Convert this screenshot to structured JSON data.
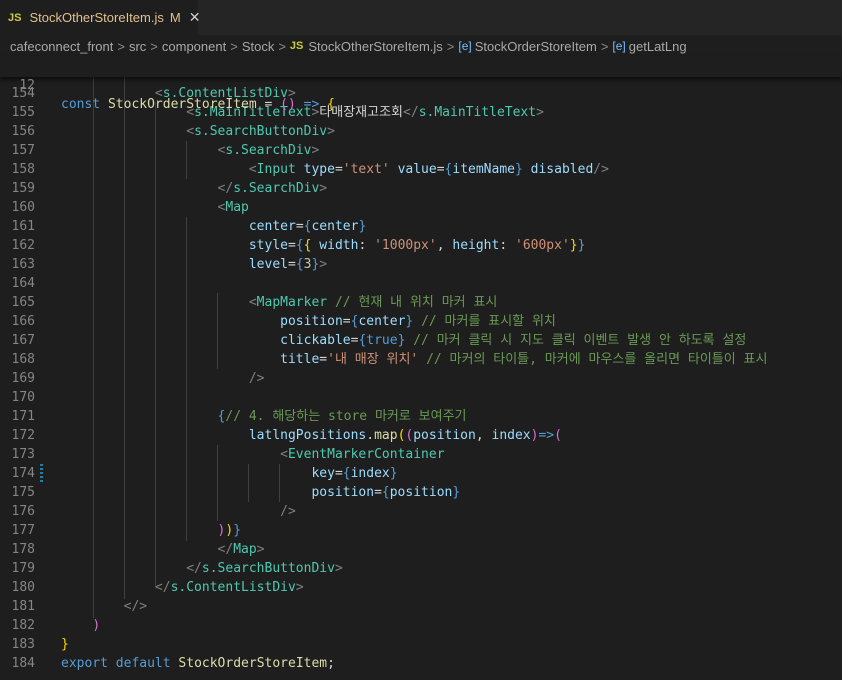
{
  "tab": {
    "icon": "JS",
    "filename": "StockOtherStoreItem.js",
    "modified": "M",
    "close": "✕"
  },
  "breadcrumb": {
    "parts": [
      "cafeconnect_front",
      "src",
      "component",
      "Stock",
      "StockOtherStoreItem.js",
      "StockOrderStoreItem",
      "getLatLng"
    ],
    "js_icon": "JS",
    "symbol_icon": "[e]",
    "separator": ">"
  },
  "sticky": {
    "line_number": "12",
    "kw": "const",
    "name": "StockOrderStoreItem",
    "rest1": " = ",
    "paren": "()",
    "rest2": " => ",
    "brace": "{"
  },
  "lines": [
    {
      "n": "154",
      "t": [
        [
          "txt",
          "            "
        ],
        [
          "br",
          "<"
        ],
        [
          "cmp",
          "s.ContentListDiv"
        ],
        [
          "br",
          ">"
        ]
      ]
    },
    {
      "n": "155",
      "t": [
        [
          "txt",
          "                "
        ],
        [
          "br",
          "<"
        ],
        [
          "cmp",
          "s.MainTitleText"
        ],
        [
          "br",
          ">"
        ],
        [
          "txt",
          "타매장재고조회"
        ],
        [
          "br",
          "</"
        ],
        [
          "cmp",
          "s.MainTitleText"
        ],
        [
          "br",
          ">"
        ]
      ]
    },
    {
      "n": "156",
      "t": [
        [
          "txt",
          "                "
        ],
        [
          "br",
          "<"
        ],
        [
          "cmp",
          "s.SearchButtonDiv"
        ],
        [
          "br",
          ">"
        ]
      ]
    },
    {
      "n": "157",
      "t": [
        [
          "txt",
          "                    "
        ],
        [
          "br",
          "<"
        ],
        [
          "cmp",
          "s.SearchDiv"
        ],
        [
          "br",
          ">"
        ]
      ]
    },
    {
      "n": "158",
      "t": [
        [
          "txt",
          "                        "
        ],
        [
          "br",
          "<"
        ],
        [
          "cmp",
          "Input"
        ],
        [
          "txt",
          " "
        ],
        [
          "attr",
          "type"
        ],
        [
          "txt",
          "="
        ],
        [
          "str",
          "'text'"
        ],
        [
          "txt",
          " "
        ],
        [
          "attr",
          "value"
        ],
        [
          "txt",
          "="
        ],
        [
          "kw",
          "{"
        ],
        [
          "attr",
          "itemName"
        ],
        [
          "kw",
          "}"
        ],
        [
          "txt",
          " "
        ],
        [
          "attr",
          "disabled"
        ],
        [
          "br",
          "/>"
        ]
      ]
    },
    {
      "n": "159",
      "t": [
        [
          "txt",
          "                    "
        ],
        [
          "br",
          "</"
        ],
        [
          "cmp",
          "s.SearchDiv"
        ],
        [
          "br",
          ">"
        ]
      ]
    },
    {
      "n": "160",
      "t": [
        [
          "txt",
          "                    "
        ],
        [
          "br",
          "<"
        ],
        [
          "cmp",
          "Map"
        ]
      ]
    },
    {
      "n": "161",
      "t": [
        [
          "txt",
          "                        "
        ],
        [
          "attr",
          "center"
        ],
        [
          "txt",
          "="
        ],
        [
          "kw",
          "{"
        ],
        [
          "attr",
          "center"
        ],
        [
          "kw",
          "}"
        ]
      ]
    },
    {
      "n": "162",
      "t": [
        [
          "txt",
          "                        "
        ],
        [
          "attr",
          "style"
        ],
        [
          "txt",
          "="
        ],
        [
          "kw",
          "{"
        ],
        [
          "b1",
          "{"
        ],
        [
          "txt",
          " "
        ],
        [
          "attr",
          "width"
        ],
        [
          "txt",
          ": "
        ],
        [
          "str",
          "'1000px'"
        ],
        [
          "txt",
          ", "
        ],
        [
          "attr",
          "height"
        ],
        [
          "txt",
          ": "
        ],
        [
          "str",
          "'600px'"
        ],
        [
          "b1",
          "}"
        ],
        [
          "kw",
          "}"
        ]
      ]
    },
    {
      "n": "163",
      "t": [
        [
          "txt",
          "                        "
        ],
        [
          "attr",
          "level"
        ],
        [
          "txt",
          "="
        ],
        [
          "kw",
          "{"
        ],
        [
          "num",
          "3"
        ],
        [
          "kw",
          "}"
        ],
        [
          "br",
          ">"
        ]
      ]
    },
    {
      "n": "164",
      "t": []
    },
    {
      "n": "165",
      "t": [
        [
          "txt",
          "                        "
        ],
        [
          "br",
          "<"
        ],
        [
          "cmp",
          "MapMarker"
        ],
        [
          "txt",
          " "
        ],
        [
          "cm",
          "// 현재 내 위치 마커 표시"
        ]
      ]
    },
    {
      "n": "166",
      "t": [
        [
          "txt",
          "                            "
        ],
        [
          "attr",
          "position"
        ],
        [
          "txt",
          "="
        ],
        [
          "kw",
          "{"
        ],
        [
          "attr",
          "center"
        ],
        [
          "kw",
          "}"
        ],
        [
          "txt",
          " "
        ],
        [
          "cm",
          "// 마커를 표시할 위치"
        ]
      ]
    },
    {
      "n": "167",
      "t": [
        [
          "txt",
          "                            "
        ],
        [
          "attr",
          "clickable"
        ],
        [
          "txt",
          "="
        ],
        [
          "kw",
          "{true}"
        ],
        [
          "txt",
          " "
        ],
        [
          "cm",
          "// 마커 클릭 시 지도 클릭 이벤트 발생 안 하도록 설정"
        ]
      ]
    },
    {
      "n": "168",
      "t": [
        [
          "txt",
          "                            "
        ],
        [
          "attr",
          "title"
        ],
        [
          "txt",
          "="
        ],
        [
          "str",
          "'내 매장 위치'"
        ],
        [
          "txt",
          " "
        ],
        [
          "cm",
          "// 마커의 타이틀, 마커에 마우스를 올리면 타이틀이 표시"
        ]
      ]
    },
    {
      "n": "169",
      "t": [
        [
          "txt",
          "                        "
        ],
        [
          "br",
          "/>"
        ]
      ]
    },
    {
      "n": "170",
      "t": []
    },
    {
      "n": "171",
      "t": [
        [
          "txt",
          "                    "
        ],
        [
          "kw",
          "{"
        ],
        [
          "cm",
          "// 4. 해당하는 store 마커로 보여주기"
        ]
      ]
    },
    {
      "n": "172",
      "t": [
        [
          "txt",
          "                        "
        ],
        [
          "attr",
          "latlngPositions"
        ],
        [
          "txt",
          "."
        ],
        [
          "fn",
          "map"
        ],
        [
          "b1",
          "("
        ],
        [
          "b2",
          "("
        ],
        [
          "attr",
          "position"
        ],
        [
          "txt",
          ", "
        ],
        [
          "attr",
          "index"
        ],
        [
          "b2",
          ")"
        ],
        [
          "kw",
          "=>"
        ],
        [
          "b2",
          "("
        ]
      ]
    },
    {
      "n": "173",
      "t": [
        [
          "txt",
          "                            "
        ],
        [
          "br",
          "<"
        ],
        [
          "cmp",
          "EventMarkerContainer"
        ]
      ]
    },
    {
      "n": "174",
      "t": [
        [
          "txt",
          "                                "
        ],
        [
          "attr",
          "key"
        ],
        [
          "txt",
          "="
        ],
        [
          "kw",
          "{"
        ],
        [
          "attr",
          "index"
        ],
        [
          "kw",
          "}"
        ]
      ]
    },
    {
      "n": "175",
      "t": [
        [
          "txt",
          "                                "
        ],
        [
          "attr",
          "position"
        ],
        [
          "txt",
          "="
        ],
        [
          "kw",
          "{"
        ],
        [
          "attr",
          "position"
        ],
        [
          "kw",
          "}"
        ]
      ]
    },
    {
      "n": "176",
      "t": [
        [
          "txt",
          "                            "
        ],
        [
          "br",
          "/>"
        ]
      ]
    },
    {
      "n": "177",
      "t": [
        [
          "txt",
          "                    "
        ],
        [
          "b2",
          ")"
        ],
        [
          "b1",
          ")"
        ],
        [
          "kw",
          "}"
        ]
      ]
    },
    {
      "n": "178",
      "t": [
        [
          "txt",
          "                    "
        ],
        [
          "br",
          "</"
        ],
        [
          "cmp",
          "Map"
        ],
        [
          "br",
          ">"
        ]
      ]
    },
    {
      "n": "179",
      "t": [
        [
          "txt",
          "                "
        ],
        [
          "br",
          "</"
        ],
        [
          "cmp",
          "s.SearchButtonDiv"
        ],
        [
          "br",
          ">"
        ]
      ]
    },
    {
      "n": "180",
      "t": [
        [
          "txt",
          "            "
        ],
        [
          "br",
          "</"
        ],
        [
          "cmp",
          "s.ContentListDiv"
        ],
        [
          "br",
          ">"
        ]
      ]
    },
    {
      "n": "181",
      "t": [
        [
          "txt",
          "        "
        ],
        [
          "br",
          "</>"
        ]
      ]
    },
    {
      "n": "182",
      "t": [
        [
          "txt",
          "    "
        ],
        [
          "b2",
          ")"
        ]
      ]
    },
    {
      "n": "183",
      "t": [
        [
          "b1",
          "}"
        ]
      ]
    },
    {
      "n": "184",
      "t": [
        [
          "kw",
          "export"
        ],
        [
          "txt",
          " "
        ],
        [
          "kw",
          "default"
        ],
        [
          "txt",
          " "
        ],
        [
          "fn",
          "StockOrderStoreItem"
        ],
        [
          "txt",
          ";"
        ]
      ]
    }
  ]
}
